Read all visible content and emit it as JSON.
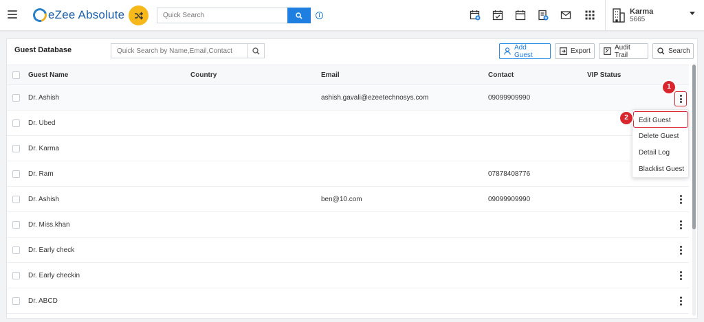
{
  "app": {
    "name": "eZee Absolute"
  },
  "topbar": {
    "search_placeholder": "Quick Search",
    "icons": [
      "calendar-plus-icon",
      "calendar-check-icon",
      "calendar-icon",
      "receipt-icon",
      "mail-icon",
      "apps-grid-icon"
    ],
    "user": {
      "name": "Karma",
      "code": "5665"
    }
  },
  "panel": {
    "title": "Guest Database",
    "search_placeholder": "Quick Search by Name,Email,Contact",
    "buttons": {
      "add_guest": "Add Guest",
      "export": "Export",
      "audit_trail": "Audit Trail",
      "search": "Search"
    }
  },
  "table": {
    "columns": {
      "name": "Guest Name",
      "country": "Country",
      "email": "Email",
      "contact": "Contact",
      "vip": "VIP Status"
    },
    "rows": [
      {
        "name": "Dr. Ashish",
        "country": "",
        "email": "ashish.gavali@ezeetechnosys.com",
        "contact": "09099909990",
        "vip": ""
      },
      {
        "name": "Dr. Ubed",
        "country": "",
        "email": "",
        "contact": "",
        "vip": ""
      },
      {
        "name": "Dr. Karma",
        "country": "",
        "email": "",
        "contact": "",
        "vip": ""
      },
      {
        "name": "Dr. Ram",
        "country": "",
        "email": "",
        "contact": "07878408776",
        "vip": ""
      },
      {
        "name": "Dr. Ashish",
        "country": "",
        "email": "ben@10.com",
        "contact": "09099909990",
        "vip": ""
      },
      {
        "name": "Dr. Miss.khan",
        "country": "",
        "email": "",
        "contact": "",
        "vip": ""
      },
      {
        "name": "Dr. Early check",
        "country": "",
        "email": "",
        "contact": "",
        "vip": ""
      },
      {
        "name": "Dr. Early checkin",
        "country": "",
        "email": "",
        "contact": "",
        "vip": ""
      },
      {
        "name": "Dr. ABCD",
        "country": "",
        "email": "",
        "contact": "",
        "vip": ""
      }
    ]
  },
  "row_menu": {
    "items": [
      "Edit Guest",
      "Delete Guest",
      "Detail Log",
      "Blacklist Guest"
    ]
  },
  "callouts": {
    "step1": "1",
    "step2": "2"
  },
  "colors": {
    "accent": "#1e7fe0",
    "brand_yellow": "#f7b91a",
    "highlight": "#d9262e"
  }
}
